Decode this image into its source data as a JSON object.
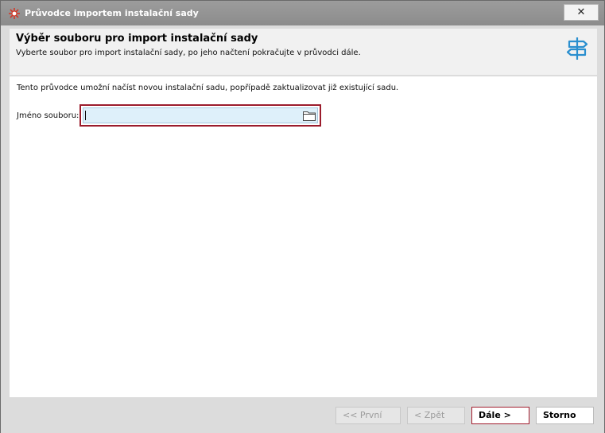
{
  "window": {
    "title": "Průvodce importem instalační sady",
    "close_label": "✕"
  },
  "header": {
    "title": "Výběr souboru pro import instalační sady",
    "subtitle": "Vyberte soubor pro import instalační sady, po jeho načtení pokračujte v průvodci dále."
  },
  "content": {
    "intro": "Tento průvodce umožní načíst novou instalační sadu, popřípadě zaktualizovat již existující sadu.",
    "file_label": "Jméno souboru:",
    "file_value": ""
  },
  "footer": {
    "first_label": "<< První",
    "back_label": "< Zpět",
    "next_label": "Dále >",
    "cancel_label": "Storno"
  },
  "icons": {
    "app": "starburst-icon",
    "header": "signpost-icon",
    "browse": "folder-icon"
  },
  "colors": {
    "accent": "#9b1c2c",
    "input_bg": "#def0fa",
    "signpost": "#2a8fcf"
  }
}
